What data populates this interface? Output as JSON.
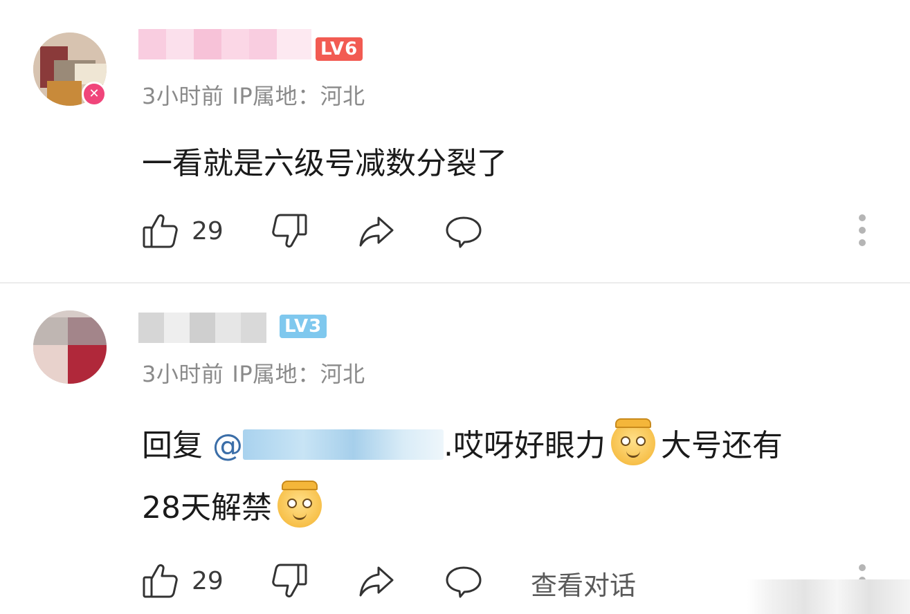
{
  "colors": {
    "level_badge_6": "#f25b52",
    "level_badge_3": "#7fc8ee",
    "mention": "#3b6ea8",
    "meta_text": "#8a8a8a",
    "avatar_badge": "#f0457a"
  },
  "comments": [
    {
      "level": "LV6",
      "time": "3小时前",
      "ip_location": "IP属地：河北",
      "content": "一看就是六级号减数分裂了",
      "like_count": "29",
      "avatar_badge_icon": "pink-badge-icon"
    },
    {
      "level": "LV3",
      "time": "3小时前",
      "ip_location": "IP属地：河北",
      "reply_prefix": "回复 ",
      "mention_at": "@",
      "content_after_mention": ".哎呀好眼力",
      "content_mid": "大号还有",
      "content_line2": "28天解禁",
      "emoji_icons": [
        "doge-emoji-icon",
        "monkey-king-emoji-icon"
      ],
      "like_count": "29",
      "view_conversation": "查看对话"
    }
  ]
}
